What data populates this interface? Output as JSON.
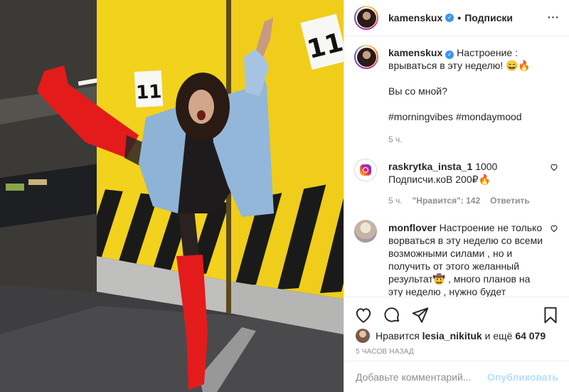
{
  "post": {
    "username": "kamenskux",
    "separator": "•",
    "follow_label": "Подписки",
    "caption": {
      "line1_text": " Настроение : врываться в эту неделю! 😄🔥",
      "line2_text": "Вы со мной?",
      "hashtags": "#morningvibes #mondaymood",
      "time": "5 ч."
    },
    "photo": {
      "sign_left": "11",
      "sign_right": "11"
    }
  },
  "comments": [
    {
      "username": "raskrytka_insta_1",
      "text": " 1000 Подписчи.коВ 200₽🔥",
      "time": "5 ч.",
      "likes": "\"Нравится\": 142",
      "reply": "Ответить"
    },
    {
      "username": "monflover",
      "text": " Настроение не только ворваться в эту неделю со всеми возможными силами , но и получить от этого желанный результат🤠 , много планов на эту неделю , нужно будет"
    }
  ],
  "actions": {
    "liked_by_prefix": "Нравится",
    "liked_by_user": "lesia_nikituk",
    "liked_by_and": "и ещё",
    "liked_by_count": "64 079",
    "time_ago": "5 ЧАСОВ НАЗАД",
    "comment_placeholder": "Добавьте комментарий...",
    "publish_label": "Опубликовать"
  },
  "icons": {
    "more": "more-options-icon",
    "like": "heart-icon",
    "comment": "comment-bubble-icon",
    "share": "paper-plane-icon",
    "save": "bookmark-icon",
    "verified": "verified-badge-icon"
  },
  "colors": {
    "accent_blue": "#3897f0",
    "hashtag": "#00376b",
    "muted": "#8e8e8e",
    "publish_disabled": "#b2dffc",
    "wall_yellow": "#f2d21c",
    "boots_red": "#e31b1b"
  }
}
